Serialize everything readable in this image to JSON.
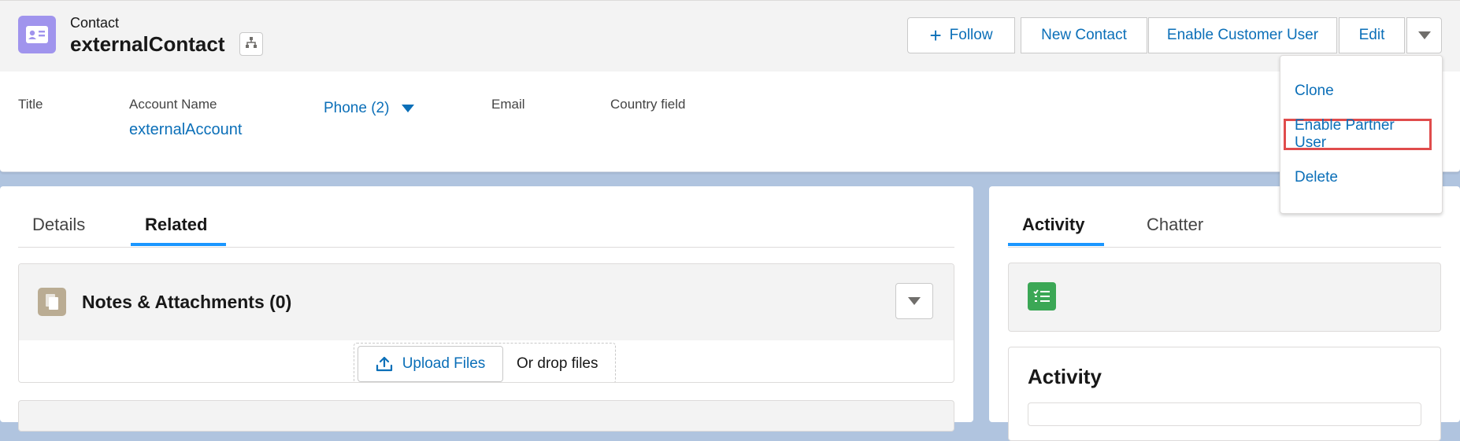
{
  "header": {
    "object_label": "Contact",
    "record_name": "externalContact",
    "icon": "contact-card-icon",
    "hierarchy_icon": "hierarchy-icon",
    "actions": {
      "follow": "Follow",
      "new_contact": "New Contact",
      "enable_customer_user": "Enable Customer User",
      "edit": "Edit"
    }
  },
  "highlights": {
    "title_label": "Title",
    "account_label": "Account Name",
    "account_value": "externalAccount",
    "phone_label": "Phone (2)",
    "email_label": "Email",
    "country_label": "Country field"
  },
  "dropdown": {
    "items": [
      "Clone",
      "Enable Partner User",
      "Delete"
    ],
    "highlighted": "Enable Partner User",
    "highlight_color": "#e04c4c"
  },
  "left_tabs": [
    "Details",
    "Related"
  ],
  "left_active_tab": "Related",
  "notes_card": {
    "title": "Notes & Attachments (0)",
    "upload_label": "Upload Files",
    "drop_text": "Or drop files",
    "icon": "file-icon"
  },
  "right_tabs": [
    "Activity",
    "Chatter"
  ],
  "right_active_tab": "Activity",
  "activity_card": {
    "title": "Activity",
    "task_icon": "task-list-icon"
  },
  "colors": {
    "link": "#0b6fb8",
    "tab_underline": "#1b96ff",
    "page_bg": "#b0c4df",
    "contact_icon_bg": "#a094ed",
    "notes_icon_bg": "#baac93",
    "task_icon_bg": "#3ba755"
  }
}
